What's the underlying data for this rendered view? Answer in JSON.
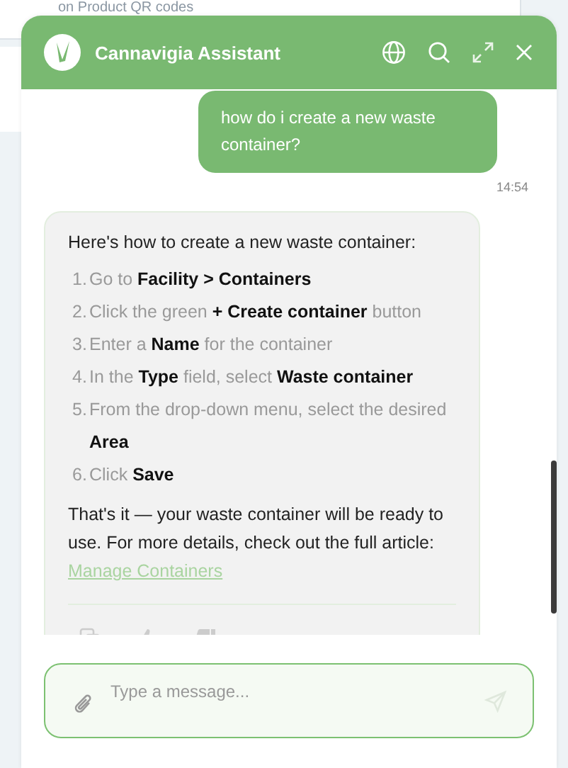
{
  "background": {
    "caption": "on Product QR codes"
  },
  "chat": {
    "title": "Cannavigia Assistant",
    "messages": [
      {
        "kind": "user",
        "text": "how do i create a new waste container?",
        "time": "14:54"
      },
      {
        "kind": "assistant",
        "intro": "Here's how to create a new waste container:",
        "steps": [
          {
            "number": "1.",
            "text": "Go to **Facility > Containers**"
          },
          {
            "number": "2.",
            "text": "Click the green **+ Create container** button"
          },
          {
            "number": "3.",
            "text": "Enter a **Name** for the container"
          },
          {
            "number": "4.",
            "text": "In the **Type** field, select **Waste container**"
          },
          {
            "number": "5.",
            "text": "From the drop-down menu, select the desired **Area**"
          },
          {
            "number": "6.",
            "text": "Click **Save**"
          }
        ],
        "outro": "That's it — your waste container will be ready to use. For more details, check out the full article:",
        "link": "Manage Containers"
      }
    ],
    "input": {
      "placeholder": "Type a message..."
    }
  }
}
